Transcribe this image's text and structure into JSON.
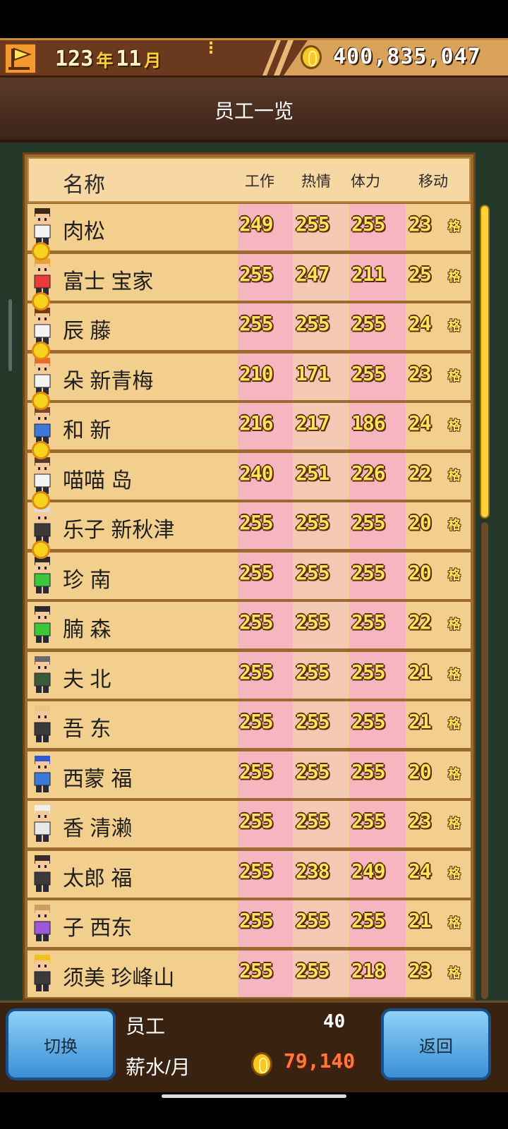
{
  "top_bar": {
    "year": "123",
    "year_unit": "年",
    "month": "11",
    "month_unit": "月",
    "money": "400,835,047"
  },
  "header": {
    "title": "员工一览"
  },
  "columns": {
    "name": "名称",
    "work": "工作",
    "passion": "热情",
    "stamina": "体力",
    "move": "移动"
  },
  "grid_unit": "格",
  "staff": [
    {
      "name": "肉松",
      "work": "249",
      "passion": "255",
      "stamina": "255",
      "move": "23"
    },
    {
      "name": "富士 宝家",
      "work": "255",
      "passion": "247",
      "stamina": "211",
      "move": "25"
    },
    {
      "name": "辰 藤",
      "work": "255",
      "passion": "255",
      "stamina": "255",
      "move": "24"
    },
    {
      "name": "朵 新青梅",
      "work": "210",
      "passion": "171",
      "stamina": "255",
      "move": "23"
    },
    {
      "name": "和 新",
      "work": "216",
      "passion": "217",
      "stamina": "186",
      "move": "24"
    },
    {
      "name": "喵喵 岛",
      "work": "240",
      "passion": "251",
      "stamina": "226",
      "move": "22"
    },
    {
      "name": "乐子 新秋津",
      "work": "255",
      "passion": "255",
      "stamina": "255",
      "move": "20"
    },
    {
      "name": "珍 南",
      "work": "255",
      "passion": "255",
      "stamina": "255",
      "move": "20"
    },
    {
      "name": "腩 森",
      "work": "255",
      "passion": "255",
      "stamina": "255",
      "move": "22"
    },
    {
      "name": "夫 北",
      "work": "255",
      "passion": "255",
      "stamina": "255",
      "move": "21"
    },
    {
      "name": "吾 东",
      "work": "255",
      "passion": "255",
      "stamina": "255",
      "move": "21"
    },
    {
      "name": "西蒙 福",
      "work": "255",
      "passion": "255",
      "stamina": "255",
      "move": "20"
    },
    {
      "name": "香 清濑",
      "work": "255",
      "passion": "255",
      "stamina": "255",
      "move": "23"
    },
    {
      "name": "太郎 福",
      "work": "255",
      "passion": "238",
      "stamina": "249",
      "move": "24"
    },
    {
      "name": "子 西东",
      "work": "255",
      "passion": "255",
      "stamina": "255",
      "move": "21"
    },
    {
      "name": "须美 珍峰山",
      "work": "255",
      "passion": "255",
      "stamina": "218",
      "move": "23"
    }
  ],
  "bottom": {
    "switch_label": "切换",
    "back_label": "返回",
    "staff_label": "员工",
    "staff_count": "40",
    "salary_label": "薪水/月",
    "salary_value": "79,140"
  },
  "colors": {
    "stat_bg_pink": "#f6b6c0",
    "row_bg": "#f3cf8e",
    "accent_button": "#3a8fd6"
  }
}
